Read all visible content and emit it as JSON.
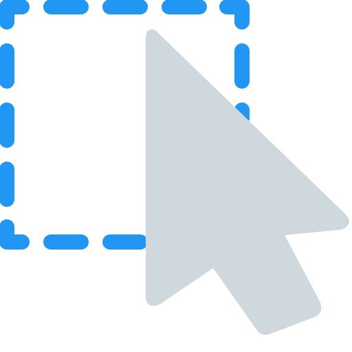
{
  "icon": {
    "name": "area-selection-cursor-icon",
    "selection_marquee": {
      "icon_name": "dashed-selection-rectangle",
      "color": "#2196F3",
      "style": "dashed"
    },
    "cursor": {
      "icon_name": "mouse-pointer-arrow",
      "color": "#CFD8DC"
    },
    "background_color": "#FFFFFF"
  }
}
